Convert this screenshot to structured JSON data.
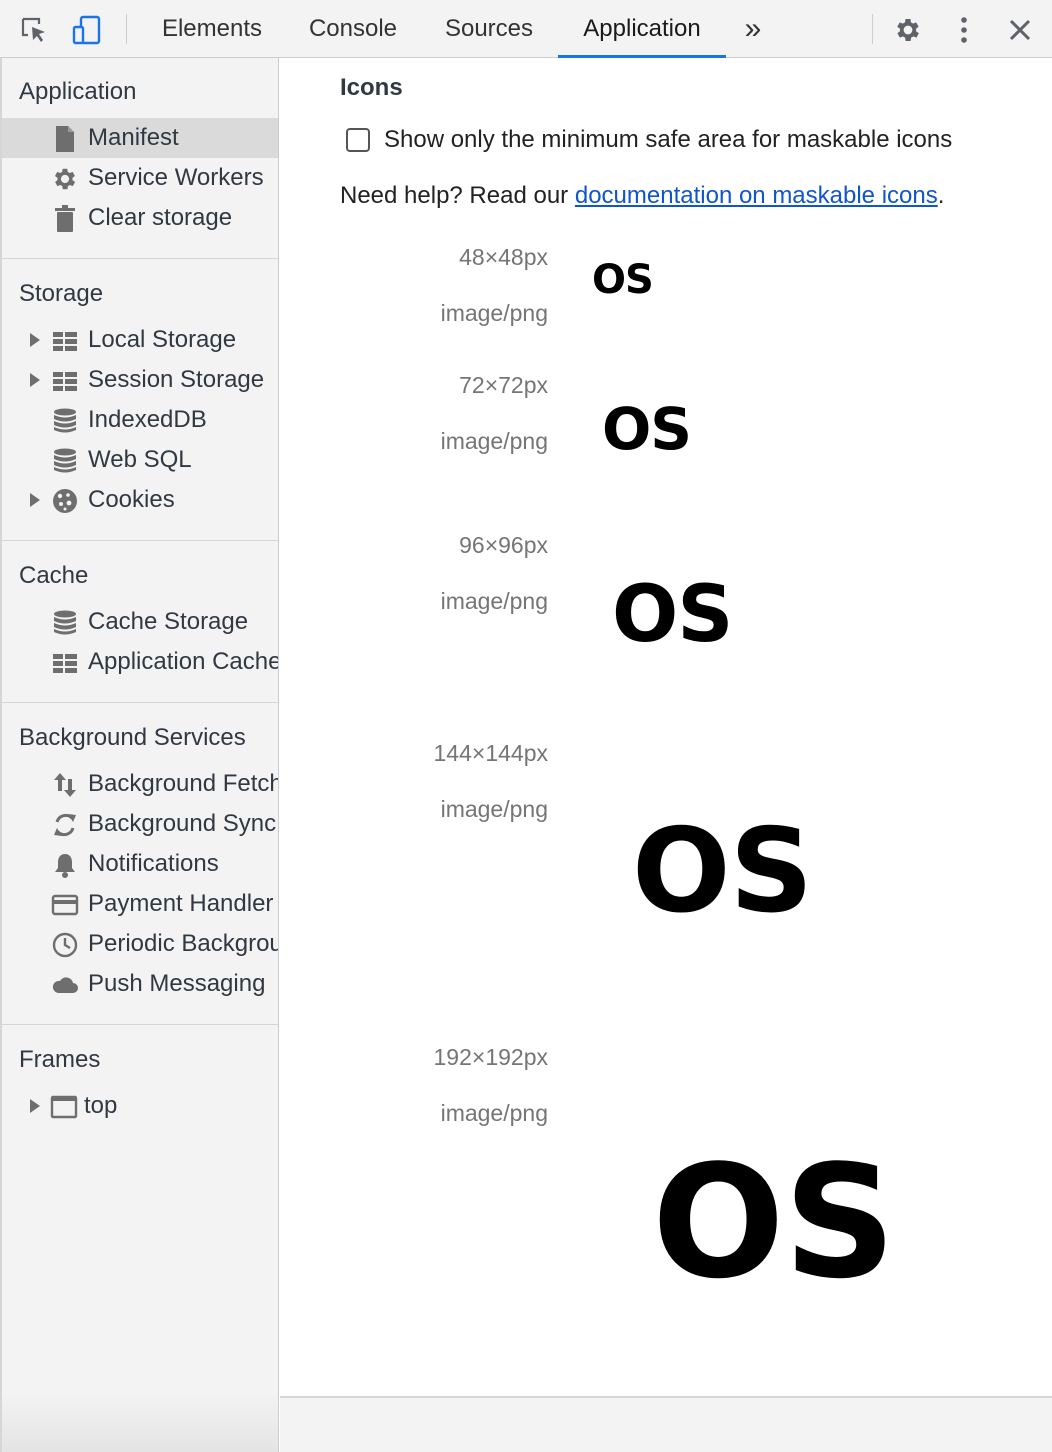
{
  "toolbar": {
    "tabs": [
      {
        "label": "Elements"
      },
      {
        "label": "Console"
      },
      {
        "label": "Sources"
      },
      {
        "label": "Application"
      }
    ],
    "more_label": "»",
    "active_tab": "Application",
    "accent_color": "#1a73e8"
  },
  "sidebar": {
    "sections": [
      {
        "title": "Application",
        "items": [
          {
            "label": "Manifest",
            "icon": "document-icon"
          },
          {
            "label": "Service Workers",
            "icon": "gear-icon"
          },
          {
            "label": "Clear storage",
            "icon": "trash-icon"
          }
        ]
      },
      {
        "title": "Storage",
        "items": [
          {
            "label": "Local Storage",
            "icon": "table-icon"
          },
          {
            "label": "Session Storage",
            "icon": "table-icon"
          },
          {
            "label": "IndexedDB",
            "icon": "database-icon"
          },
          {
            "label": "Web SQL",
            "icon": "database-icon"
          },
          {
            "label": "Cookies",
            "icon": "cookie-icon"
          }
        ]
      },
      {
        "title": "Cache",
        "items": [
          {
            "label": "Cache Storage",
            "icon": "database-icon"
          },
          {
            "label": "Application Cache",
            "icon": "table-icon"
          }
        ]
      },
      {
        "title": "Background Services",
        "items": [
          {
            "label": "Background Fetch",
            "icon": "up-down-arrows-icon"
          },
          {
            "label": "Background Sync",
            "icon": "sync-icon"
          },
          {
            "label": "Notifications",
            "icon": "bell-icon"
          },
          {
            "label": "Payment Handler",
            "icon": "credit-card-icon"
          },
          {
            "label": "Periodic Background Sync",
            "icon": "clock-icon"
          },
          {
            "label": "Push Messaging",
            "icon": "cloud-icon"
          }
        ]
      },
      {
        "title": "Frames",
        "items": [
          {
            "label": "top",
            "icon": "frame-icon"
          }
        ]
      }
    ]
  },
  "main": {
    "section_title": "Icons",
    "checkbox_label": "Show only the minimum safe area for maskable icons",
    "checkbox_checked": false,
    "help_prefix": "Need help? Read our ",
    "help_link": "documentation on maskable icons",
    "help_suffix": ".",
    "icons": [
      {
        "size": "48×48px",
        "type": "image/png",
        "glyph": "OS"
      },
      {
        "size": "72×72px",
        "type": "image/png",
        "glyph": "OS"
      },
      {
        "size": "96×96px",
        "type": "image/png",
        "glyph": "OS"
      },
      {
        "size": "144×144px",
        "type": "image/png",
        "glyph": "OS"
      },
      {
        "size": "192×192px",
        "type": "image/png",
        "glyph": "OS"
      }
    ]
  }
}
